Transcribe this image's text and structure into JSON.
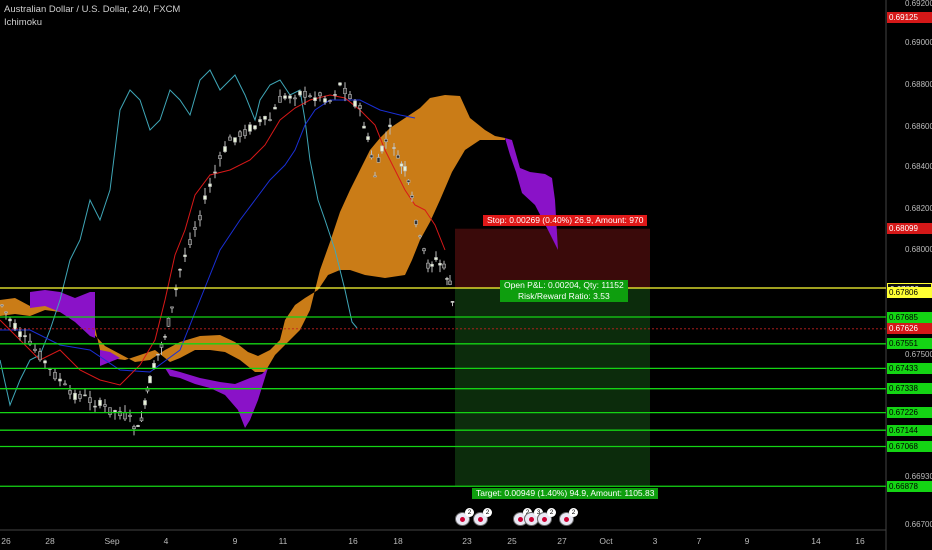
{
  "header": {
    "title": "Australian Dollar / U.S. Dollar, 240, FXCM",
    "indicator": "Ichimoku"
  },
  "colors": {
    "background": "#000000",
    "kumo_bull": "#e08a1a",
    "kumo_bear": "#8a12c8",
    "tenkan": "#d81818",
    "kijun": "#1a2fd6",
    "chikou": "#3fa7b8",
    "hline_green": "#14d414",
    "hline_yellow": "#ffff33",
    "stop_zone": "#3a0a0a",
    "target_zone": "#0c2c0c"
  },
  "annotations": {
    "stop": "Stop: 0.00269 (0.40%) 26.9, Amount: 970",
    "open_pl": "Open P&L: 0.00204, Qty: 11152",
    "risk_reward": "Risk/Reward Ratio: 3.53",
    "target": "Target: 0.00949 (1.40%) 94.9, Amount: 1105.83"
  },
  "events": [
    {
      "count": "2"
    },
    {
      "count": "2"
    },
    {
      "count": "2"
    },
    {
      "count": "3"
    },
    {
      "count": "2"
    },
    {
      "count": "2"
    }
  ],
  "chart_data": {
    "type": "candlestick",
    "symbol": "AUDUSD",
    "timeframe": "240",
    "y_ticks": [
      "0.69200",
      "0.69000",
      "0.68800",
      "0.68600",
      "0.68400",
      "0.68200",
      "0.68000",
      "0.67500",
      "0.66930",
      "0.66700"
    ],
    "x_ticks": [
      "26",
      "28",
      "Sep",
      "4",
      "9",
      "11",
      "16",
      "18",
      "23",
      "25",
      "27",
      "Oct",
      "3",
      "7",
      "9",
      "14",
      "16"
    ],
    "horizontal_lines": [
      {
        "value": "0.67830",
        "color": "yellow"
      },
      {
        "value": "0.67685",
        "color": "green"
      },
      {
        "value": "0.67551",
        "color": "green"
      },
      {
        "value": "0.67433",
        "color": "green"
      },
      {
        "value": "0.67338",
        "color": "green"
      },
      {
        "value": "0.67226",
        "color": "green"
      },
      {
        "value": "0.67144",
        "color": "green"
      },
      {
        "value": "0.67068",
        "color": "green"
      },
      {
        "value": "0.66881",
        "color": "green"
      }
    ],
    "price_labels": [
      {
        "value": "0.69125",
        "bg": "#d41818"
      },
      {
        "value": "0.68099",
        "bg": "#d41818"
      },
      {
        "value": "0.67830",
        "bg": "#111111"
      },
      {
        "value": "0.67806",
        "bg": "#ffff33"
      },
      {
        "value": "0.67685",
        "bg": "#14d414"
      },
      {
        "value": "0.67626",
        "bg": "#d41818"
      },
      {
        "value": "0.67551",
        "bg": "#14d414"
      },
      {
        "value": "0.67433",
        "bg": "#14d414"
      },
      {
        "value": "0.67338",
        "bg": "#14d414"
      },
      {
        "value": "0.67226",
        "bg": "#14d414"
      },
      {
        "value": "0.67144",
        "bg": "#14d414"
      },
      {
        "value": "0.67068",
        "bg": "#14d414"
      },
      {
        "value": "0.66881",
        "bg": "#14d414"
      },
      {
        "value": "0.66878",
        "bg": "#14d414"
      }
    ],
    "position": {
      "type": "short",
      "entry": 0.6783,
      "stop": 0.68099,
      "target": 0.66881
    }
  }
}
